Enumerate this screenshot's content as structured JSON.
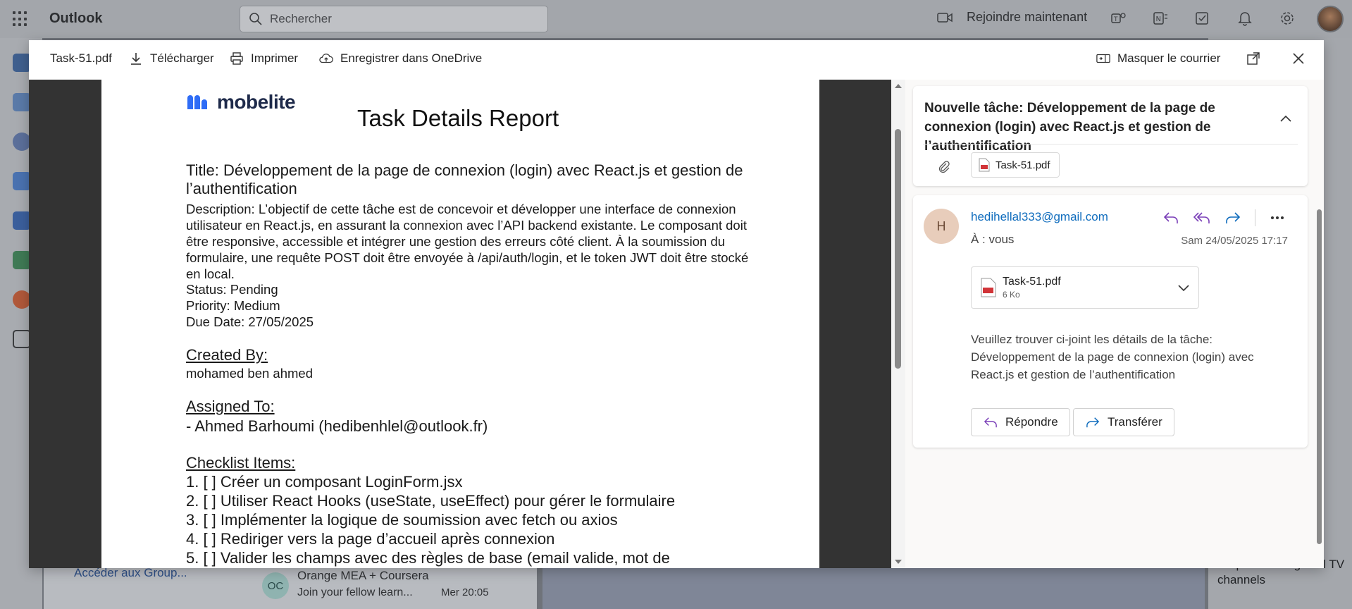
{
  "outlook": {
    "app_name": "Outlook",
    "search_placeholder": "Rechercher",
    "join_now": "Rejoindre maintenant",
    "bg_group": "Accéder aux Group...",
    "bg_mail": {
      "avatar": "OC",
      "sender": "Orange MEA + Coursera",
      "subject": "Join your fellow learn...",
      "date": "Mer 20:05"
    },
    "bg_ad": "simple trick to get all TV channels"
  },
  "viewer": {
    "filename": "Task-51.pdf",
    "download": "Télécharger",
    "print": "Imprimer",
    "save_onedrive": "Enregistrer dans OneDrive",
    "hide_mail": "Masquer le courrier"
  },
  "pdf": {
    "logo": "mobelite",
    "report_title": "Task Details Report",
    "title_line": "Title: Développement de la page de connexion (login) avec React.js et gestion de l’authentification",
    "description": "Description: L’objectif de cette tâche est de concevoir et développer une interface de connexion utilisateur en React.js, en assurant la connexion avec l’API backend existante. Le composant doit être responsive, accessible et intégrer une gestion des erreurs côté client. À la soumission du formulaire, une requête POST doit être envoyée à /api/auth/login, et le token JWT doit être stocké en local.",
    "status": "Status: Pending",
    "priority": "Priority: Medium",
    "due_date": "Due Date: 27/05/2025",
    "created_by_label": "Created By:",
    "created_by": "mohamed ben ahmed",
    "assigned_to_label": "Assigned To:",
    "assigned_to": "- Ahmed Barhoumi (hedibenhlel@outlook.fr)",
    "checklist_label": "Checklist Items:",
    "checklist": [
      "1. [ ] Créer un composant LoginForm.jsx",
      "2. [ ] Utiliser React Hooks (useState, useEffect) pour gérer le formulaire",
      "3. [ ] Implémenter la logique de soumission avec fetch ou axios",
      "4. [ ] Rediriger vers la page d’accueil après connexion",
      "5. [ ] Valider les champs avec des règles de base (email valide, mot de"
    ]
  },
  "mail": {
    "subject": "Nouvelle tâche: Développement de la page de connexion (login) avec React.js et gestion de l’authentification",
    "attachment_chip": "Task-51.pdf",
    "sender_initial": "H",
    "sender": "hedihellal333@gmail.com",
    "to": "À :  vous",
    "date": "Sam 24/05/2025 17:17",
    "attachment": {
      "name": "Task-51.pdf",
      "size": "6 Ko"
    },
    "body": "Veuillez trouver ci-joint les détails de la tâche: Développement de la page de connexion (login) avec React.js et gestion de l’authentification",
    "reply": "Répondre",
    "forward": "Transférer"
  },
  "colors": {
    "accent": "#0f6cbd",
    "pdf_gutter": "#333333",
    "reply_purple": "#7a3fb8"
  }
}
